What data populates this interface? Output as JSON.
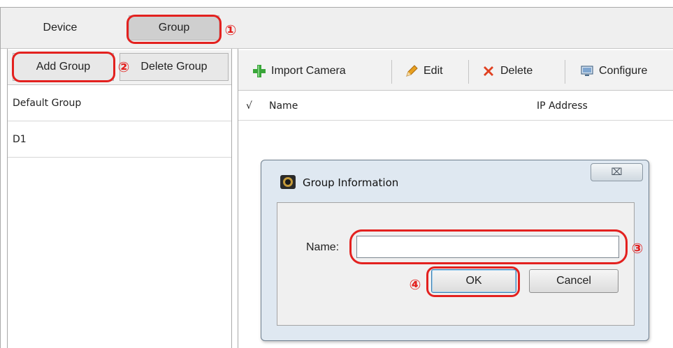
{
  "tabs": [
    {
      "label": "Device"
    },
    {
      "label": "Group"
    }
  ],
  "left_toolbar": {
    "add_label": "Add Group",
    "delete_label": "Delete Group"
  },
  "groups": [
    {
      "label": "Default Group"
    },
    {
      "label": "D1"
    }
  ],
  "toolbar": {
    "import": {
      "label": "Import Camera",
      "icon": "plus-icon"
    },
    "edit": {
      "label": "Edit",
      "icon": "pencil-icon"
    },
    "delete": {
      "label": "Delete",
      "icon": "x-icon"
    },
    "configure": {
      "label": "Configure",
      "icon": "monitor-icon"
    }
  },
  "table": {
    "columns": [
      "√",
      "Name",
      "IP Address"
    ]
  },
  "dialog": {
    "title": "Group Information",
    "close_glyph": "⌧",
    "name_label": "Name:",
    "name_value": "",
    "ok_label": "OK",
    "cancel_label": "Cancel"
  },
  "annotations": {
    "step1": "①",
    "step2": "②",
    "step3": "③",
    "step4": "④"
  },
  "colors": {
    "annotation": "#e3211f",
    "dialog_bg": "#dfe8f1",
    "toolbar_bg": "#f2f2f2",
    "icon_plus": "#3aa63a",
    "icon_delete": "#e04020",
    "icon_edit": "#e8a020"
  }
}
